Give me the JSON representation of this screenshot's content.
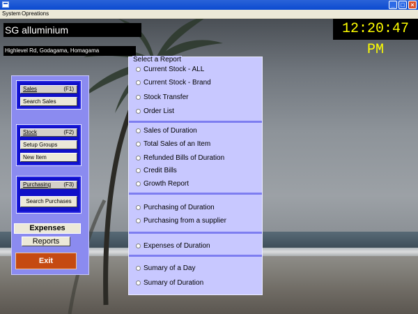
{
  "window": {
    "menu": [
      "System",
      "Opreations"
    ]
  },
  "header": {
    "company_name": "SG alluminium",
    "address": "Highlevel Rd, Godagama, Homagama",
    "clock": "12:20:47 PM"
  },
  "nav": {
    "sales": {
      "label": "Sales",
      "shortcut": "(F1)",
      "search": "Search Sales"
    },
    "stock": {
      "label": "Stock",
      "shortcut": "(F2)",
      "setup_groups": "Setup Groups",
      "new_item": "New Item"
    },
    "purchasing": {
      "label": "Purchasing",
      "shortcut": "(F3)",
      "search": "Search Purchases"
    },
    "expenses": "Expenses",
    "reports": "Reports",
    "exit": "Exit"
  },
  "reports": {
    "legend": "Select a Report",
    "items": [
      "Current Stock - ALL",
      "Current Stock - Brand",
      "Stock Transfer",
      "Order List",
      "Sales of Duration",
      "Total Sales of an Item",
      "Refunded Bills of Duration",
      "Credit Bills",
      "Growth Report",
      "Purchasing of Duration",
      "Purchasing from a supplier",
      "Expenses of Duration",
      "Sumary of a Day",
      "Sumary of Duration"
    ]
  },
  "colors": {
    "panel_blue": "#8b8bf0",
    "group_blue": "#1010c8",
    "report_bg": "#c8c8ff",
    "clock_text": "#ffff00",
    "exit_bg": "#c54a12"
  }
}
